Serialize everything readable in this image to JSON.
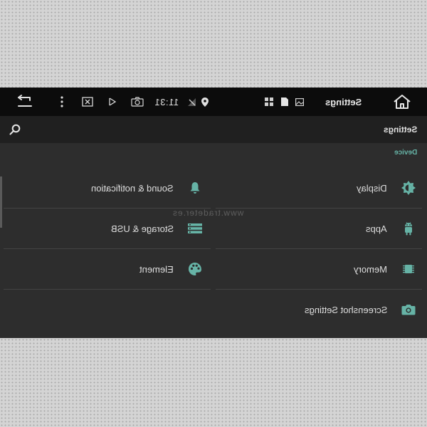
{
  "status_bar": {
    "time": "11:31",
    "title": "Settings"
  },
  "action_bar": {
    "title": "Settings"
  },
  "section": {
    "header": "Device"
  },
  "items": [
    {
      "label": "Display",
      "icon": "brightness-icon"
    },
    {
      "label": "Sound & notification",
      "icon": "bell-icon"
    },
    {
      "label": "Apps",
      "icon": "android-icon"
    },
    {
      "label": "Storage & USB",
      "icon": "storage-icon"
    },
    {
      "label": "Memory",
      "icon": "memory-chip-icon"
    },
    {
      "label": "Element",
      "icon": "palette-icon"
    },
    {
      "label": "Screenshot Settings",
      "icon": "camera-icon"
    }
  ],
  "watermark": "www.tradeter.es",
  "colors": {
    "accent": "#66b3a6",
    "background": "#2d2d2d",
    "status_bar": "#0c0c0c",
    "action_bar": "#202020"
  }
}
